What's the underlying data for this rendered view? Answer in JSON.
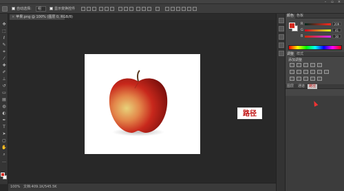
{
  "options_bar": {
    "auto_select_label": "自动选择:",
    "auto_select_value": "组",
    "show_transform_label": "显示变换控件"
  },
  "document": {
    "tab_title": "苹果.png @ 100% (图层 0, RGB/8)",
    "close_glyph": "×",
    "zoom": "100%",
    "doc_size": "文档:409.1K/545.5K"
  },
  "overlay": {
    "label": "路径"
  },
  "panels": {
    "color": {
      "tabs": [
        "颜色",
        "色板"
      ],
      "channels": [
        {
          "label": "R",
          "value": "209"
        },
        {
          "label": "G",
          "value": "41"
        },
        {
          "label": "B",
          "value": "30"
        }
      ],
      "fg_color": "#d42a1e",
      "bg_color": "#ffffff"
    },
    "adjustments": {
      "tabs": [
        "调整",
        "样式"
      ],
      "subtitle": "添加调整"
    },
    "layers": {
      "tabs": [
        "图层",
        "通道",
        "路径"
      ],
      "active_tab": "路径"
    }
  },
  "colors": {
    "app_bg": "#282828",
    "panel_bg": "#464646",
    "accent_red": "#c01010"
  }
}
